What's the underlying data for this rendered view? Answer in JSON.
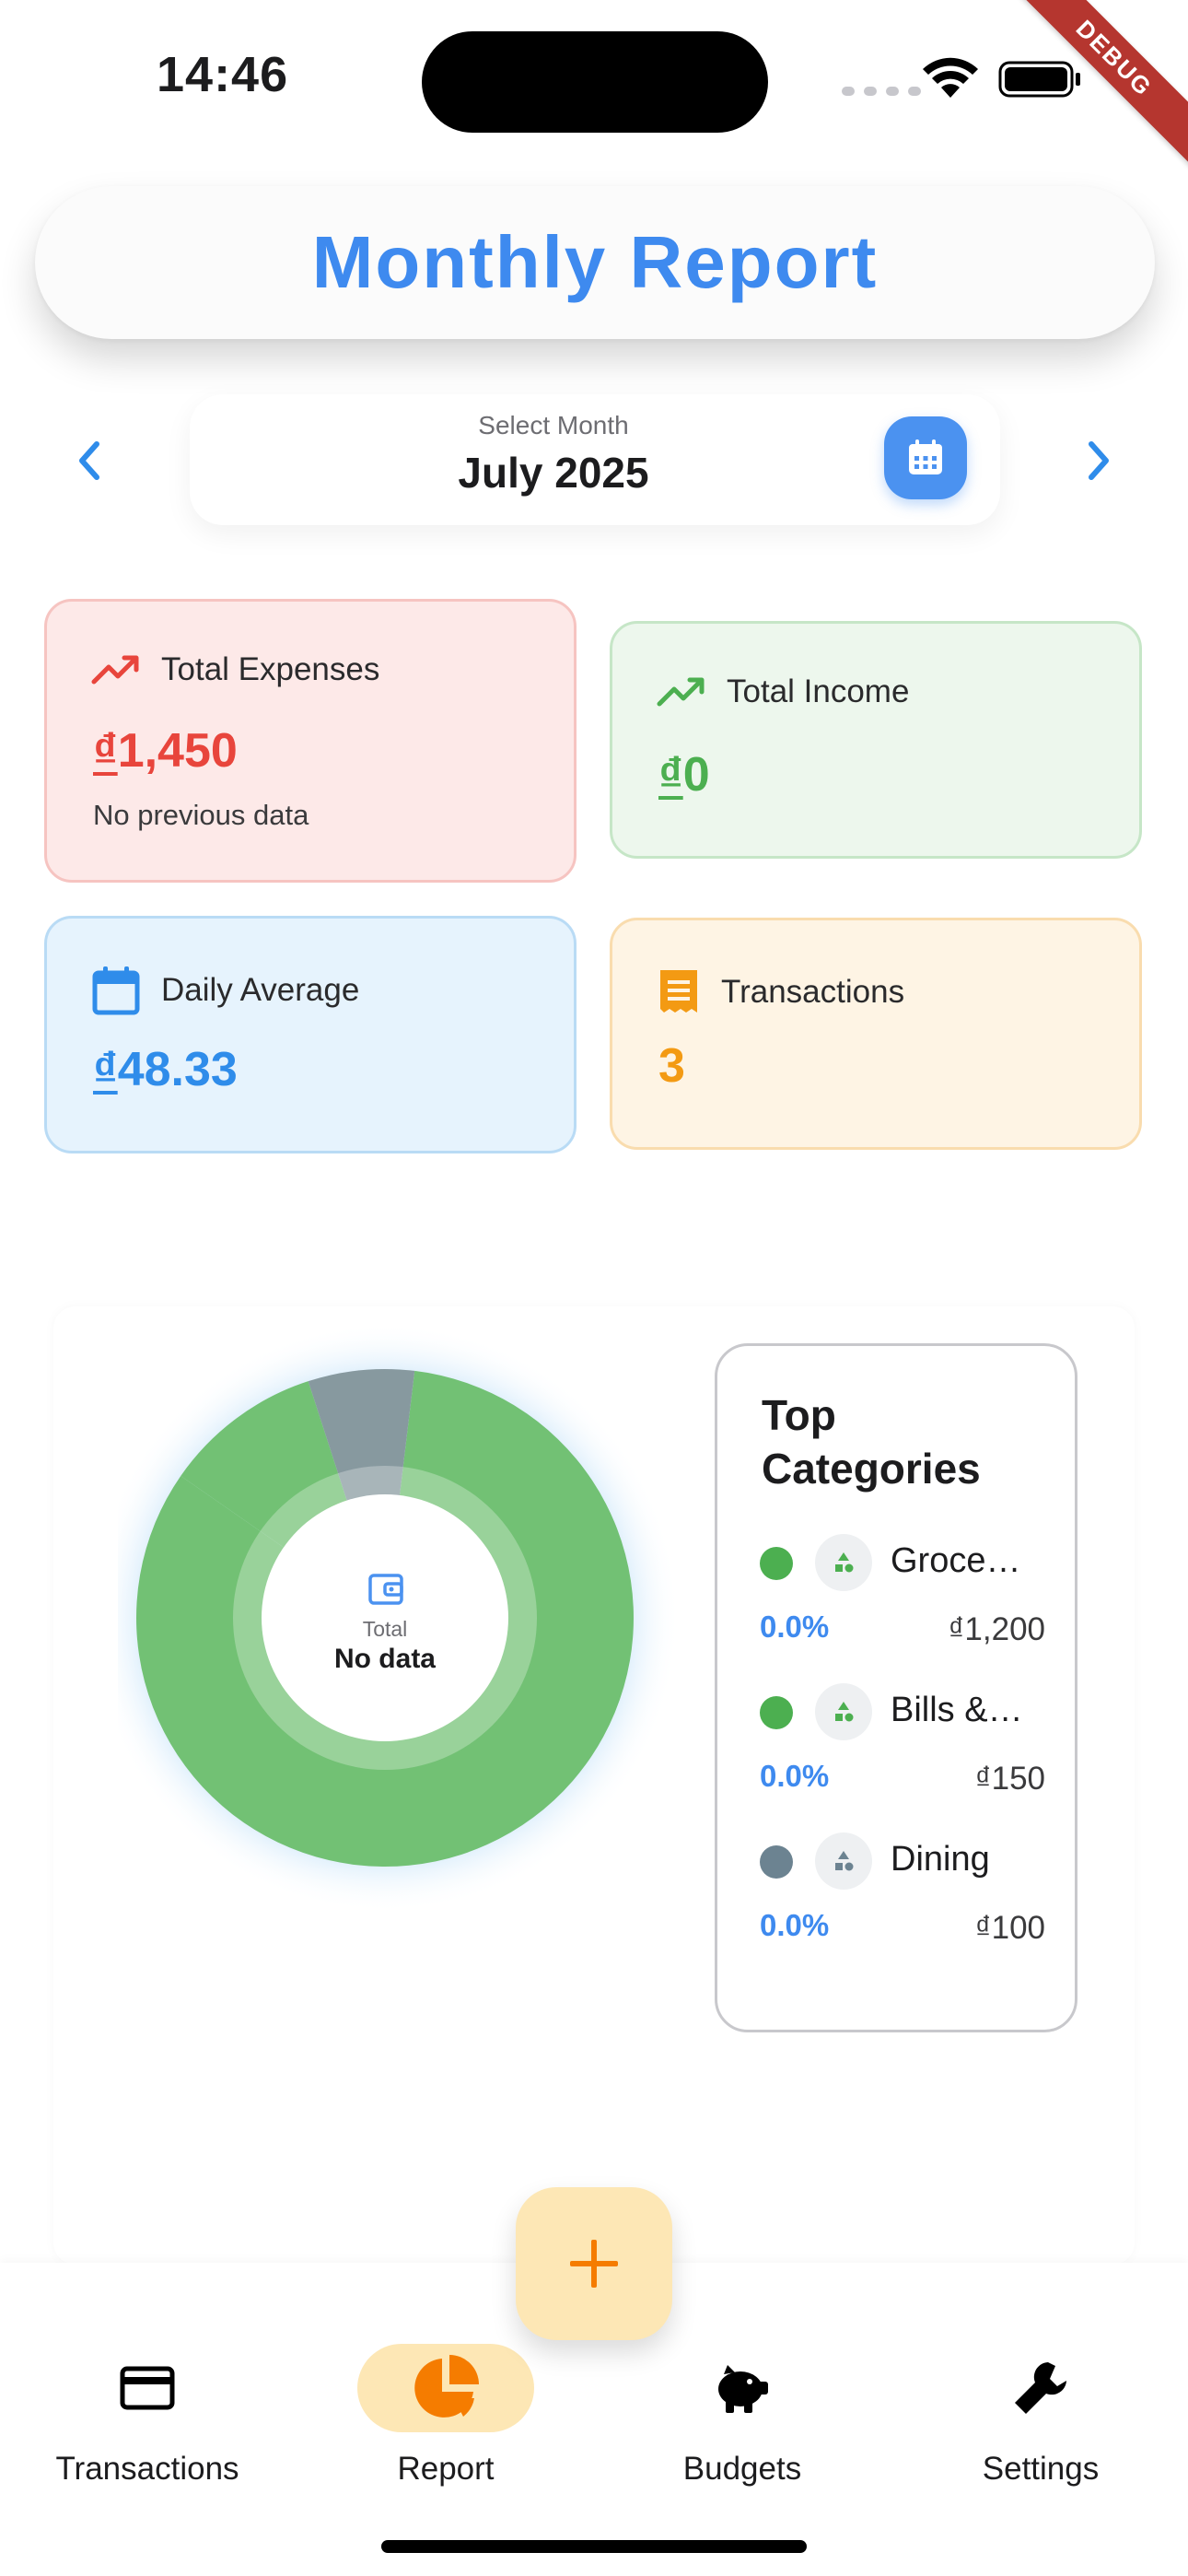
{
  "status_bar": {
    "time": "14:46",
    "debug_label": "DEBUG"
  },
  "header": {
    "title": "Monthly Report"
  },
  "month_selector": {
    "hint": "Select Month",
    "value": "July 2025"
  },
  "stats": {
    "expenses": {
      "label": "Total Expenses",
      "currency": "₫",
      "value": "1,450",
      "sub": "No previous data",
      "color": "#e8453c"
    },
    "income": {
      "label": "Total Income",
      "currency": "₫",
      "value": "0",
      "color": "#4caf50"
    },
    "daily_average": {
      "label": "Daily Average",
      "currency": "₫",
      "value": "48.33",
      "color": "#2f8cea"
    },
    "transactions": {
      "label": "Transactions",
      "value": "3",
      "color": "#f39a13"
    }
  },
  "chart_data": {
    "type": "pie",
    "center_label": "Total",
    "center_value": "No data",
    "slices": [
      {
        "category": "Groce…",
        "amount": 1200,
        "color": "#72c174"
      },
      {
        "category": "Bills &…",
        "amount": 150,
        "color": "#72c174"
      },
      {
        "category": "Dining",
        "amount": 100,
        "color": "#87999f"
      }
    ]
  },
  "legend": {
    "title": "Top Categories",
    "items": [
      {
        "name": "Groce…",
        "pct": "0.0%",
        "amount": "₫1,200",
        "dot_color": "#4caf50"
      },
      {
        "name": "Bills &…",
        "pct": "0.0%",
        "amount": "₫150",
        "dot_color": "#4caf50"
      },
      {
        "name": "Dining",
        "pct": "0.0%",
        "amount": "₫100",
        "dot_color": "#6c8391"
      }
    ]
  },
  "fab": {
    "icon": "plus-icon"
  },
  "bottom_nav": {
    "items": [
      {
        "label": "Transactions",
        "icon": "card-icon"
      },
      {
        "label": "Report",
        "icon": "pie-chart-icon",
        "active": true
      },
      {
        "label": "Budgets",
        "icon": "piggy-bank-icon"
      },
      {
        "label": "Settings",
        "icon": "wrench-icon"
      }
    ]
  }
}
